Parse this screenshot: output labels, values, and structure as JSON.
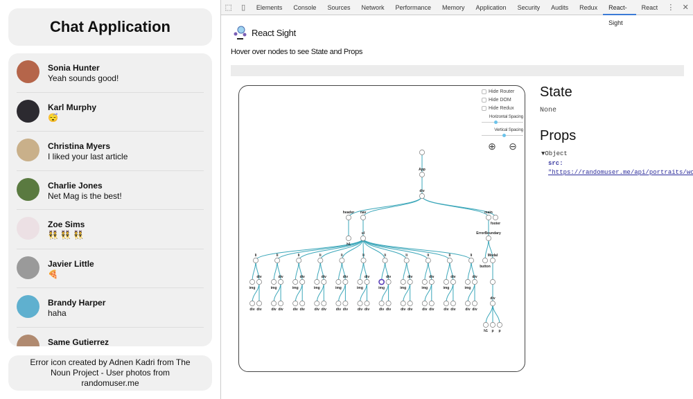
{
  "app": {
    "title": "Chat Application",
    "chats": [
      {
        "name": "Sonia Hunter",
        "message": "Yeah sounds good!",
        "avatar_color": "#b5654a"
      },
      {
        "name": "Karl Murphy",
        "message": "😴",
        "avatar_color": "#2c2a30"
      },
      {
        "name": "Christina Myers",
        "message": "I liked your last article",
        "avatar_color": "#c9b08a"
      },
      {
        "name": "Charlie Jones",
        "message": "Net Mag is the best!",
        "avatar_color": "#5a7a40"
      },
      {
        "name": "Zoe Sims",
        "message": "👯 👯 👯",
        "avatar_color": "#ece0e4"
      },
      {
        "name": "Javier Little",
        "message": "🍕",
        "avatar_color": "#9a9a9a"
      },
      {
        "name": "Brandy Harper",
        "message": "haha",
        "avatar_color": "#5fb0cf"
      },
      {
        "name": "Same Gutierrez",
        "message": "",
        "avatar_color": "#b08a70"
      }
    ],
    "footer": "Error icon created by Adnen Kadri from The Noun Project - User photos from randomuser.me"
  },
  "devtools": {
    "tabs": [
      "Elements",
      "Console",
      "Sources",
      "Network",
      "Performance",
      "Memory",
      "Application",
      "Security",
      "Audits",
      "Redux",
      "React-Sight",
      "React"
    ],
    "active_tab": "React-Sight"
  },
  "sight": {
    "title": "React Sight",
    "hint": "Hover over nodes to see State and Props",
    "controls": {
      "hide_router": "Hide Router",
      "hide_dom": "Hide DOM",
      "hide_redux": "Hide Redux",
      "horizontal_spacing": "Horizontal Spacing",
      "vertical_spacing": "Vertical Spacing",
      "horizontal_value": 0.3,
      "vertical_value": 0.5
    },
    "state_title": "State",
    "state_value": "None",
    "props_title": "Props",
    "props_object": "▼Object",
    "props_key": "src:",
    "props_value": "\"https://randomuser.me/api/portraits/wo",
    "colors": {
      "edge": "#3aa6b9",
      "highlight": "#5a3fb8"
    },
    "tree": {
      "name": "",
      "children": [
        {
          "name": "App",
          "children": [
            {
              "name": "div",
              "children": [
                {
                  "name": "header",
                  "children": [
                    {
                      "name": "h1"
                    }
                  ]
                },
                {
                  "name": "nav",
                  "children": [
                    {
                      "name": "ul",
                      "children": "LI"
                    }
                  ]
                },
                {
                  "name": "main",
                  "children": [
                    {
                      "name": "ErrorBoundary",
                      "children": [
                        {
                          "name": "button"
                        },
                        {
                          "name": "Modal",
                          "children": [
                            {
                              "name": "",
                              "children": [
                                {
                                  "name": "div",
                                  "children": [
                                    {
                                      "name": "h1"
                                    },
                                    {
                                      "name": "p"
                                    },
                                    {
                                      "name": "p"
                                    }
                                  ]
                                }
                              ]
                            }
                          ]
                        }
                      ]
                    }
                  ]
                },
                {
                  "name": "footer"
                }
              ]
            }
          ]
        }
      ]
    },
    "list_item": {
      "name": "li",
      "children": [
        {
          "name": "img"
        },
        {
          "name": "div",
          "children": [
            {
              "name": "div"
            },
            {
              "name": "div"
            }
          ]
        }
      ]
    },
    "list_item_count": 11,
    "highlighted_list_item": 6
  }
}
